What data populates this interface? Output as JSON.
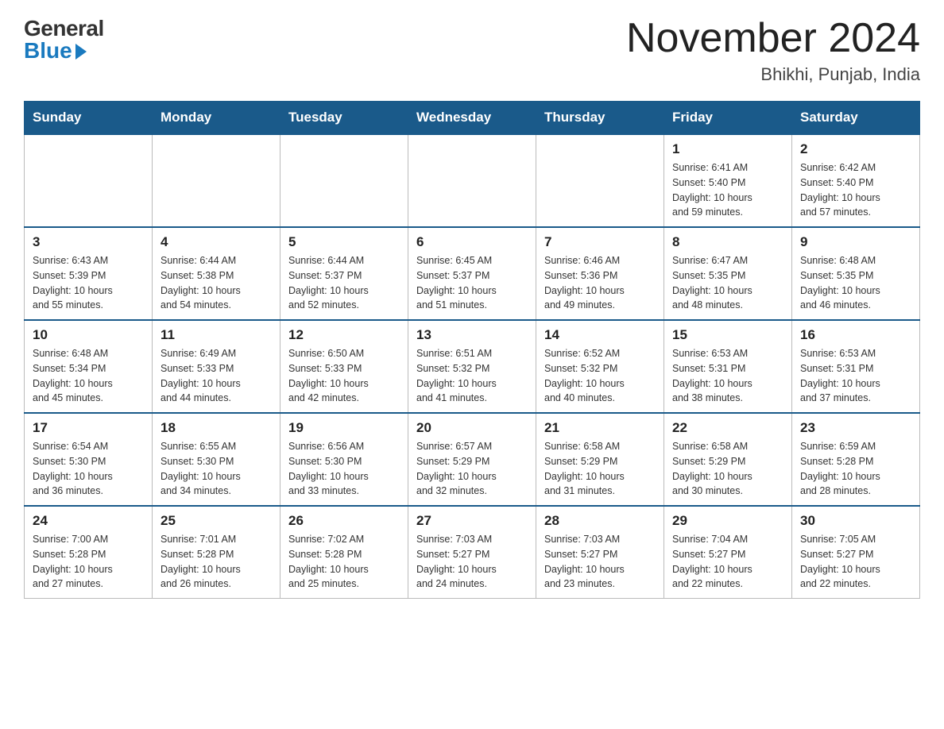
{
  "header": {
    "logo_general": "General",
    "logo_blue": "Blue",
    "month_title": "November 2024",
    "location": "Bhikhi, Punjab, India"
  },
  "weekdays": [
    "Sunday",
    "Monday",
    "Tuesday",
    "Wednesday",
    "Thursday",
    "Friday",
    "Saturday"
  ],
  "weeks": [
    [
      {
        "day": "",
        "info": ""
      },
      {
        "day": "",
        "info": ""
      },
      {
        "day": "",
        "info": ""
      },
      {
        "day": "",
        "info": ""
      },
      {
        "day": "",
        "info": ""
      },
      {
        "day": "1",
        "info": "Sunrise: 6:41 AM\nSunset: 5:40 PM\nDaylight: 10 hours\nand 59 minutes."
      },
      {
        "day": "2",
        "info": "Sunrise: 6:42 AM\nSunset: 5:40 PM\nDaylight: 10 hours\nand 57 minutes."
      }
    ],
    [
      {
        "day": "3",
        "info": "Sunrise: 6:43 AM\nSunset: 5:39 PM\nDaylight: 10 hours\nand 55 minutes."
      },
      {
        "day": "4",
        "info": "Sunrise: 6:44 AM\nSunset: 5:38 PM\nDaylight: 10 hours\nand 54 minutes."
      },
      {
        "day": "5",
        "info": "Sunrise: 6:44 AM\nSunset: 5:37 PM\nDaylight: 10 hours\nand 52 minutes."
      },
      {
        "day": "6",
        "info": "Sunrise: 6:45 AM\nSunset: 5:37 PM\nDaylight: 10 hours\nand 51 minutes."
      },
      {
        "day": "7",
        "info": "Sunrise: 6:46 AM\nSunset: 5:36 PM\nDaylight: 10 hours\nand 49 minutes."
      },
      {
        "day": "8",
        "info": "Sunrise: 6:47 AM\nSunset: 5:35 PM\nDaylight: 10 hours\nand 48 minutes."
      },
      {
        "day": "9",
        "info": "Sunrise: 6:48 AM\nSunset: 5:35 PM\nDaylight: 10 hours\nand 46 minutes."
      }
    ],
    [
      {
        "day": "10",
        "info": "Sunrise: 6:48 AM\nSunset: 5:34 PM\nDaylight: 10 hours\nand 45 minutes."
      },
      {
        "day": "11",
        "info": "Sunrise: 6:49 AM\nSunset: 5:33 PM\nDaylight: 10 hours\nand 44 minutes."
      },
      {
        "day": "12",
        "info": "Sunrise: 6:50 AM\nSunset: 5:33 PM\nDaylight: 10 hours\nand 42 minutes."
      },
      {
        "day": "13",
        "info": "Sunrise: 6:51 AM\nSunset: 5:32 PM\nDaylight: 10 hours\nand 41 minutes."
      },
      {
        "day": "14",
        "info": "Sunrise: 6:52 AM\nSunset: 5:32 PM\nDaylight: 10 hours\nand 40 minutes."
      },
      {
        "day": "15",
        "info": "Sunrise: 6:53 AM\nSunset: 5:31 PM\nDaylight: 10 hours\nand 38 minutes."
      },
      {
        "day": "16",
        "info": "Sunrise: 6:53 AM\nSunset: 5:31 PM\nDaylight: 10 hours\nand 37 minutes."
      }
    ],
    [
      {
        "day": "17",
        "info": "Sunrise: 6:54 AM\nSunset: 5:30 PM\nDaylight: 10 hours\nand 36 minutes."
      },
      {
        "day": "18",
        "info": "Sunrise: 6:55 AM\nSunset: 5:30 PM\nDaylight: 10 hours\nand 34 minutes."
      },
      {
        "day": "19",
        "info": "Sunrise: 6:56 AM\nSunset: 5:30 PM\nDaylight: 10 hours\nand 33 minutes."
      },
      {
        "day": "20",
        "info": "Sunrise: 6:57 AM\nSunset: 5:29 PM\nDaylight: 10 hours\nand 32 minutes."
      },
      {
        "day": "21",
        "info": "Sunrise: 6:58 AM\nSunset: 5:29 PM\nDaylight: 10 hours\nand 31 minutes."
      },
      {
        "day": "22",
        "info": "Sunrise: 6:58 AM\nSunset: 5:29 PM\nDaylight: 10 hours\nand 30 minutes."
      },
      {
        "day": "23",
        "info": "Sunrise: 6:59 AM\nSunset: 5:28 PM\nDaylight: 10 hours\nand 28 minutes."
      }
    ],
    [
      {
        "day": "24",
        "info": "Sunrise: 7:00 AM\nSunset: 5:28 PM\nDaylight: 10 hours\nand 27 minutes."
      },
      {
        "day": "25",
        "info": "Sunrise: 7:01 AM\nSunset: 5:28 PM\nDaylight: 10 hours\nand 26 minutes."
      },
      {
        "day": "26",
        "info": "Sunrise: 7:02 AM\nSunset: 5:28 PM\nDaylight: 10 hours\nand 25 minutes."
      },
      {
        "day": "27",
        "info": "Sunrise: 7:03 AM\nSunset: 5:27 PM\nDaylight: 10 hours\nand 24 minutes."
      },
      {
        "day": "28",
        "info": "Sunrise: 7:03 AM\nSunset: 5:27 PM\nDaylight: 10 hours\nand 23 minutes."
      },
      {
        "day": "29",
        "info": "Sunrise: 7:04 AM\nSunset: 5:27 PM\nDaylight: 10 hours\nand 22 minutes."
      },
      {
        "day": "30",
        "info": "Sunrise: 7:05 AM\nSunset: 5:27 PM\nDaylight: 10 hours\nand 22 minutes."
      }
    ]
  ]
}
